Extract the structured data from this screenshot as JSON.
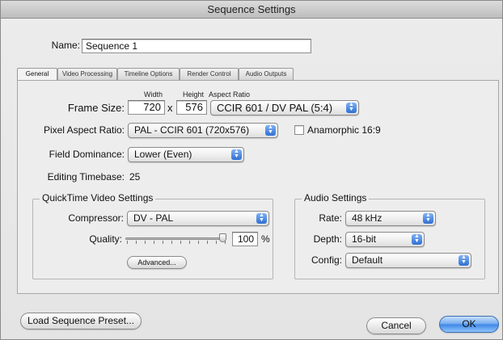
{
  "window": {
    "title": "Sequence Settings"
  },
  "name_field": {
    "label": "Name:",
    "value": "Sequence 1"
  },
  "tabs": [
    {
      "label": "General",
      "active": true
    },
    {
      "label": "Video Processing"
    },
    {
      "label": "Timeline Options"
    },
    {
      "label": "Render Control"
    },
    {
      "label": "Audio Outputs"
    }
  ],
  "frame_size": {
    "label": "Frame Size:",
    "width_caption": "Width",
    "height_caption": "Height",
    "aspect_caption": "Aspect Ratio",
    "width": "720",
    "times": "x",
    "height": "576",
    "aspect_ratio": "CCIR 601 / DV PAL (5:4)"
  },
  "pixel_aspect": {
    "label": "Pixel Aspect Ratio:",
    "value": "PAL - CCIR 601 (720x576)",
    "anamorphic_label": "Anamorphic 16:9",
    "anamorphic_checked": false
  },
  "field_dominance": {
    "label": "Field Dominance:",
    "value": "Lower (Even)"
  },
  "editing_timebase": {
    "label": "Editing Timebase:",
    "value": "25"
  },
  "quicktime": {
    "title": "QuickTime Video Settings",
    "compressor_label": "Compressor:",
    "compressor_value": "DV - PAL",
    "quality_label": "Quality:",
    "quality_value": "100",
    "quality_unit": "%",
    "quality_level": 1.0,
    "advanced_button": "Advanced..."
  },
  "audio": {
    "title": "Audio Settings",
    "rate_label": "Rate:",
    "rate_value": "48 kHz",
    "depth_label": "Depth:",
    "depth_value": "16-bit",
    "config_label": "Config:",
    "config_value": "Default"
  },
  "footer": {
    "load_preset": "Load Sequence Preset...",
    "cancel": "Cancel",
    "ok": "OK"
  },
  "colors": {
    "accent": "#3d86e6",
    "popup_arrow": "#2f6fd3"
  },
  "icons": {
    "popup_arrows": "up-down-arrows-icon"
  }
}
